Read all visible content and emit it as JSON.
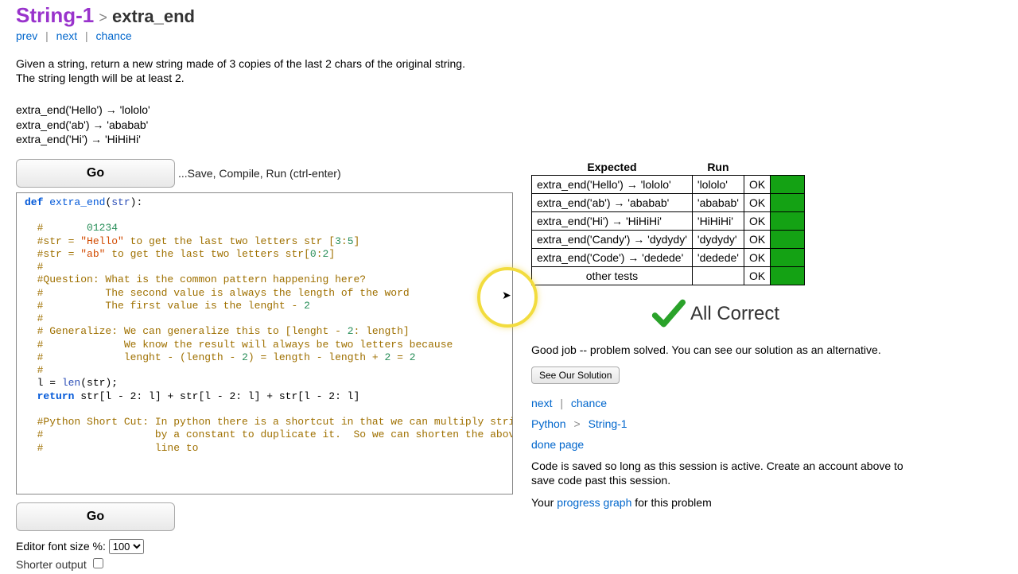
{
  "header": {
    "category": "String-1",
    "sep": ">",
    "problem": "extra_end",
    "prev": "prev",
    "next": "next",
    "chance": "chance"
  },
  "description": "Given a string, return a new string made of 3 copies of the last 2 chars of the original string. The string length will be at least 2.",
  "examples": [
    "extra_end('Hello') → 'lololo'",
    "extra_end('ab') → 'ababab'",
    "extra_end('Hi') → 'HiHiHi'"
  ],
  "go": {
    "label": "Go",
    "hint": "...Save, Compile, Run (ctrl-enter)"
  },
  "code": {
    "defkw": "def",
    "funcname": "extra_end",
    "param": "str",
    "c1_pre": "#       ",
    "c1_num": "01234",
    "c2a": "#str = ",
    "c2s": "\"Hello\"",
    "c2b": " to get the last two letters str [",
    "c2n1": "3",
    "c2n2": "5",
    "c2c": "]",
    "c3a": "#str = ",
    "c3s": "\"ab\"",
    "c3b": " to get the last two letters str[",
    "c3n1": "0",
    "c3n2": "2",
    "c3c": "]",
    "c4": "#",
    "c5": "#Question: What is the common pattern happening here?",
    "c6": "#          The second value is always the length of the word",
    "c7": "#          The first value is the lenght - ",
    "c7n": "2",
    "c8": "#",
    "c9a": "# Generalize: We can generalize this to [lenght - ",
    "c9n": "2",
    "c9b": ": length]",
    "c10": "#             We know the result will always be two letters because",
    "c11a": "#             lenght - (length - ",
    "c11n1": "2",
    "c11b": ") = length - length + ",
    "c11n2": "2",
    "c11c": " = ",
    "c11n3": "2",
    "c12": "#",
    "l_var": "l = ",
    "l_builtin": "len",
    "l_rest": "(str);",
    "ret": "return",
    "ret_expr": " str[l - 2: l] + str[l - 2: l] + str[l - 2: l]",
    "c13": "#Python Short Cut: In python there is a shortcut in that we can multiply strings",
    "c14": "#                  by a constant to duplicate it.  So we can shorten the above",
    "c15": "#                  line to"
  },
  "results": {
    "h_expected": "Expected",
    "h_run": "Run",
    "rows": [
      {
        "exp": "extra_end('Hello') → 'lololo'",
        "run": "'lololo'",
        "ok": "OK"
      },
      {
        "exp": "extra_end('ab') → 'ababab'",
        "run": "'ababab'",
        "ok": "OK"
      },
      {
        "exp": "extra_end('Hi') → 'HiHiHi'",
        "run": "'HiHiHi'",
        "ok": "OK"
      },
      {
        "exp": "extra_end('Candy') → 'dydydy'",
        "run": "'dydydy'",
        "ok": "OK"
      },
      {
        "exp": "extra_end('Code') → 'dedede'",
        "run": "'dedede'",
        "ok": "OK"
      }
    ],
    "other": "other tests",
    "other_ok": "OK"
  },
  "allcorrect": "All Correct",
  "solved_msg": "Good job -- problem solved. You can see our solution as an alternative.",
  "see_solution": "See Our Solution",
  "rightnav": {
    "next": "next",
    "chance": "chance",
    "python": "Python",
    "string1": "String-1",
    "done": "done page",
    "save_msg": "Code is saved so long as this session is active. Create an account above to save code past this session.",
    "your": "Your ",
    "progress": "progress graph",
    "forthis": " for this problem"
  },
  "fontrow": {
    "label": "Editor font size %: ",
    "value": "100"
  },
  "shorter": "Shorter output"
}
